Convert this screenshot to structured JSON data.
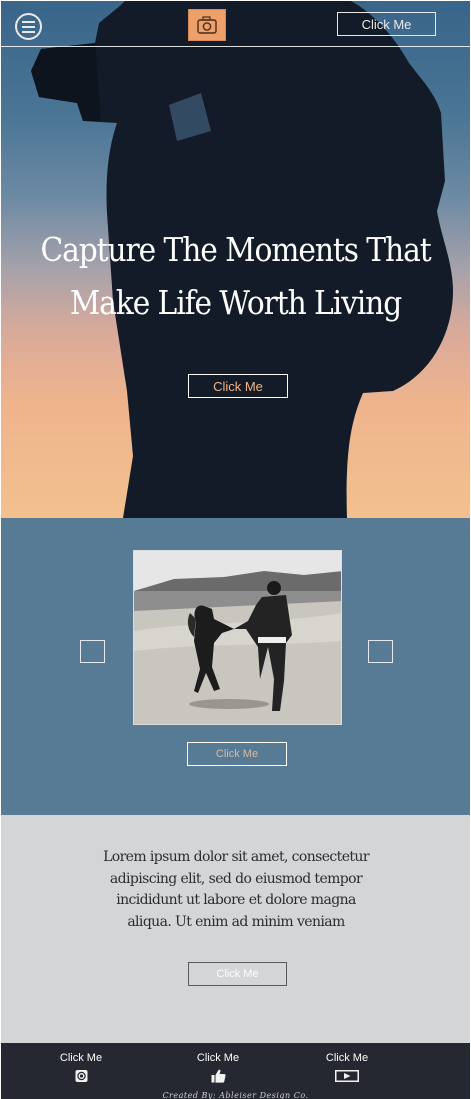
{
  "header": {
    "menu_icon": "hamburger-menu-icon",
    "logo_icon": "camera-logo-icon",
    "cta_label": "Click Me"
  },
  "hero": {
    "title_line1": "Capture The Moments That",
    "title_line2": "Make Life Worth Living",
    "cta_label": "Click Me"
  },
  "gallery": {
    "prev_icon": "previous-arrow-icon",
    "next_icon": "next-arrow-icon",
    "cta_label": "Click Me"
  },
  "about": {
    "text": "Lorem ipsum dolor sit amet, consectetur adipiscing elit, sed do eiusmod tempor incididunt ut labore et dolore magna aliqua. Ut enim ad minim veniam",
    "cta_label": "Click Me"
  },
  "footer": {
    "links": [
      {
        "label": "Click Me",
        "icon": "instagram-icon"
      },
      {
        "label": "Click Me",
        "icon": "thumbs-up-icon"
      },
      {
        "label": "Click Me",
        "icon": "video-play-icon"
      }
    ],
    "credit": "Created By: Ableiser Design Co."
  },
  "colors": {
    "hero_accent": "#f0b482",
    "gallery_bg": "#587b95",
    "about_bg": "#d4d5d7",
    "footer_bg": "#252830",
    "logo_bg": "#eea06a"
  }
}
